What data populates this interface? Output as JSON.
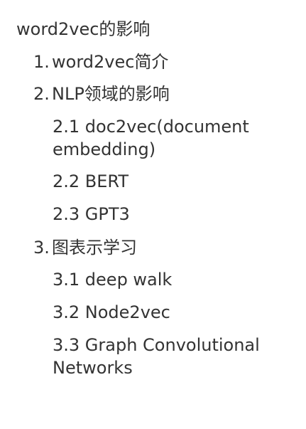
{
  "toc": {
    "title": "word2vec的影响",
    "items": [
      {
        "number": "1.",
        "label": "word2vec简介",
        "subitems": []
      },
      {
        "number": "2.",
        "label": "NLP领域的影响",
        "subitems": [
          {
            "lines": [
              "2.1 doc2vec(document",
              "embedding)"
            ]
          },
          {
            "lines": [
              "2.2 BERT"
            ]
          },
          {
            "lines": [
              "2.3 GPT3"
            ]
          }
        ]
      },
      {
        "number": "3.",
        "label": "图表示学习",
        "subitems": [
          {
            "lines": [
              "3.1 deep walk"
            ]
          },
          {
            "lines": [
              "3.2 Node2vec"
            ]
          },
          {
            "lines": [
              "3.3 Graph Convolutional",
              "Networks"
            ]
          }
        ]
      }
    ]
  }
}
